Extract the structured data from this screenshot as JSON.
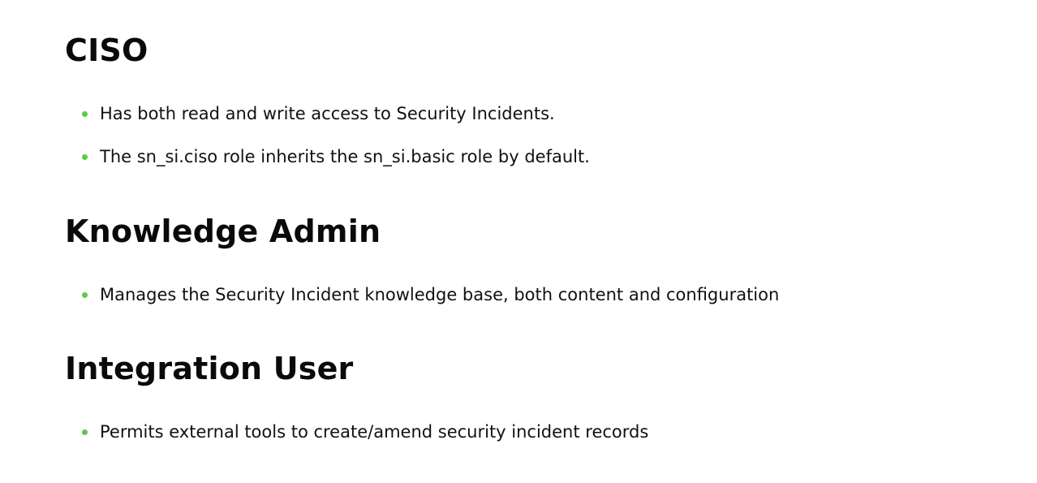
{
  "accent_color": "#5cc94a",
  "sections": [
    {
      "heading": "CISO",
      "bullets": [
        "Has both read and write access to Security Incidents.",
        "The sn_si.ciso role inherits the sn_si.basic role by default."
      ]
    },
    {
      "heading": "Knowledge Admin",
      "bullets": [
        "Manages the Security Incident knowledge base, both content and configuration"
      ]
    },
    {
      "heading": "Integration User",
      "bullets": [
        "Permits external tools to create/amend security incident records"
      ]
    }
  ]
}
